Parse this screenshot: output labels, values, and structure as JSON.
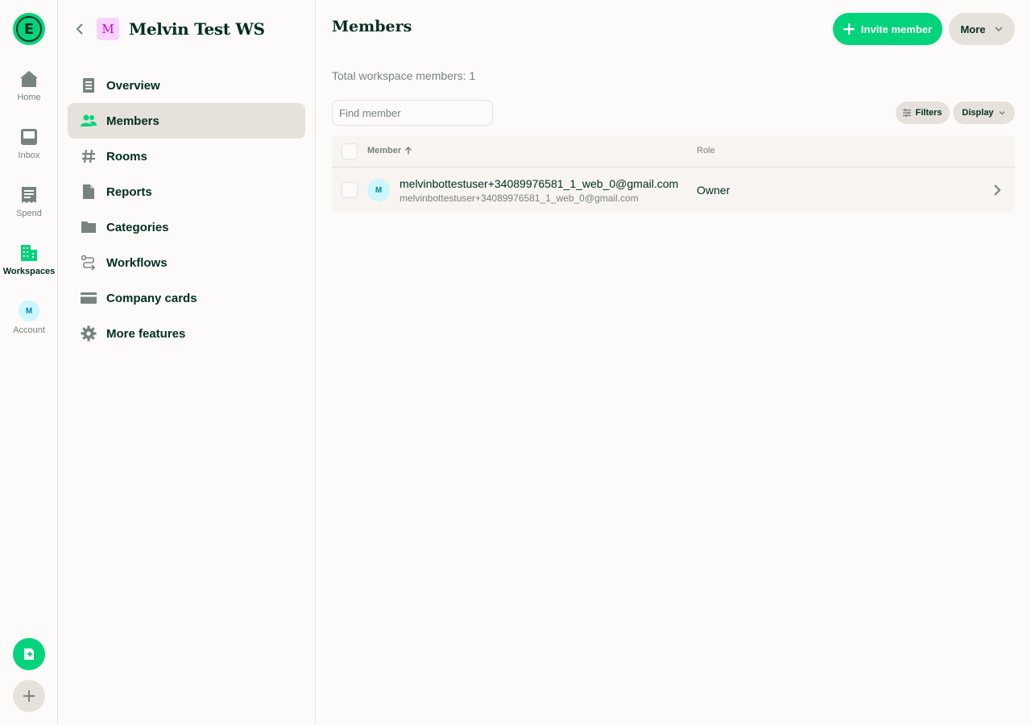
{
  "rail": {
    "logo_letter": "E",
    "items": [
      {
        "label": "Home",
        "icon": "home-icon"
      },
      {
        "label": "Inbox",
        "icon": "inbox-icon"
      },
      {
        "label": "Spend",
        "icon": "receipt-icon"
      },
      {
        "label": "Workspaces",
        "icon": "building-icon",
        "active": true
      },
      {
        "label": "Account",
        "icon": "avatar"
      }
    ],
    "account_initial": "M",
    "fab_green_icon": "new-expense-icon",
    "fab_grey_icon": "plus-icon"
  },
  "workspace": {
    "avatar_letter": "M",
    "name": "Melvin Test WS"
  },
  "menu": [
    {
      "label": "Overview",
      "icon": "overview-icon"
    },
    {
      "label": "Members",
      "icon": "users-icon",
      "active": true
    },
    {
      "label": "Rooms",
      "icon": "hashtag-icon"
    },
    {
      "label": "Reports",
      "icon": "document-icon"
    },
    {
      "label": "Categories",
      "icon": "folder-icon"
    },
    {
      "label": "Workflows",
      "icon": "workflow-icon"
    },
    {
      "label": "Company cards",
      "icon": "card-icon"
    },
    {
      "label": "More features",
      "icon": "gear-icon"
    }
  ],
  "main": {
    "title": "Members",
    "invite_label": "Invite member",
    "more_label": "More",
    "total": "Total workspace members: 1",
    "search_placeholder": "Find member",
    "filters_label": "Filters",
    "display_label": "Display",
    "columns": {
      "member": "Member",
      "role": "Role"
    },
    "rows": [
      {
        "initial": "M",
        "name": "melvinbottestuser+34089976581_1_web_0@gmail.com",
        "email": "melvinbottestuser+34089976581_1_web_0@gmail.com",
        "role": "Owner"
      }
    ]
  },
  "colors": {
    "accent": "#03d47c",
    "text": "#002e22",
    "muted": "#76847e",
    "border": "#e6e1da",
    "background": "#fcfbf9"
  }
}
